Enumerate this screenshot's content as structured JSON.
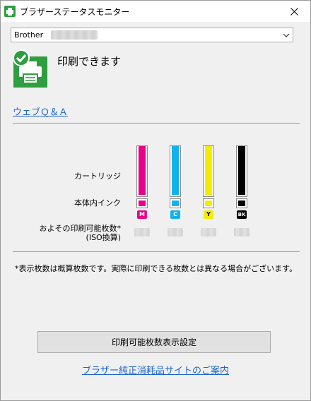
{
  "window": {
    "title": "ブラザーステータスモニター"
  },
  "printer": {
    "selected": "Brother"
  },
  "status": {
    "text": "印刷できます"
  },
  "links": {
    "qa": "ウェブＱ＆Ａ",
    "supplies_site": "ブラザー純正消耗品サイトのご案内"
  },
  "labels": {
    "cartridge": "カートリッジ",
    "internal_ink": "本体内インク",
    "estimated_pages": "およその印刷可能枚数*",
    "iso": "(ISO換算)"
  },
  "inks": [
    {
      "code": "M",
      "color": "#e8008a",
      "level": 1.0
    },
    {
      "code": "C",
      "color": "#10b2ee",
      "level": 1.0
    },
    {
      "code": "Y",
      "color": "#f4ec00",
      "level": 1.0
    },
    {
      "code": "BK",
      "color": "#000000",
      "level": 1.0
    }
  ],
  "note": "*表示枚数は概算枚数です。実際に印刷できる枚数とは異なる場合がございます。",
  "buttons": {
    "page_count_settings": "印刷可能枚数表示設定"
  },
  "colors": {
    "status_green": "#2e9e3e",
    "link": "#1a66cc"
  }
}
